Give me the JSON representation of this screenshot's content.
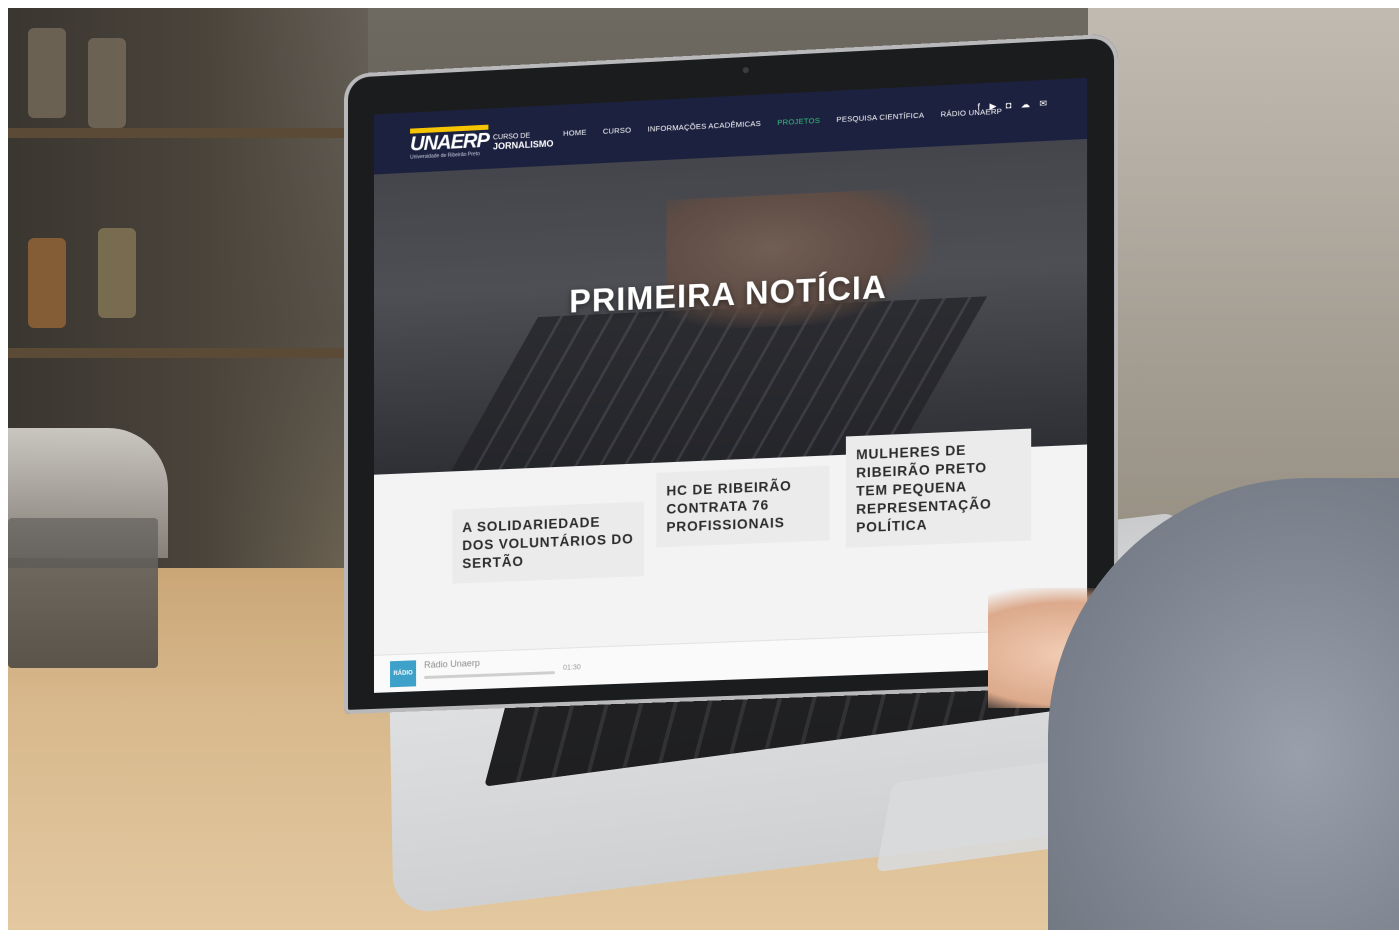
{
  "site": {
    "logo_text": "UNAERP",
    "logo_subtitle_line1": "CURSO DE",
    "logo_subtitle_line2": "JORNALISMO",
    "logo_tagline": "Universidade de Ribeirão Preto",
    "nav_items": [
      {
        "label": "HOME",
        "active": false
      },
      {
        "label": "CURSO",
        "active": false
      },
      {
        "label": "INFORMAÇÕES ACADÊMICAS",
        "active": false
      },
      {
        "label": "PROJETOS",
        "active": true
      },
      {
        "label": "PESQUISA CIENTÍFICA",
        "active": false
      },
      {
        "label": "RÁDIO UNAERP",
        "active": false
      }
    ],
    "social_icons": [
      "facebook-icon",
      "youtube-icon",
      "instagram-icon",
      "soundcloud-icon",
      "email-icon"
    ],
    "hero_title": "PRIMEIRA NOTÍCIA",
    "cards": [
      {
        "title": "A SOLIDARIEDADE DOS VOLUNTÁRIOS DO SERTÃO"
      },
      {
        "title": "HC DE RIBEIRÃO CONTRATA 76 PROFISSIONAIS"
      },
      {
        "title": "MULHERES DE RIBEIRÃO PRETO TEM PEQUENA REPRESENTAÇÃO POLÍTICA"
      }
    ],
    "player": {
      "thumb_text": "RÁDIO UNAERP",
      "title": "Rádio Unaerp",
      "time": "01:30"
    }
  },
  "colors": {
    "navbar": "#1c2140",
    "accent_active": "#35c17a",
    "logo_yellow": "#f5c300"
  }
}
